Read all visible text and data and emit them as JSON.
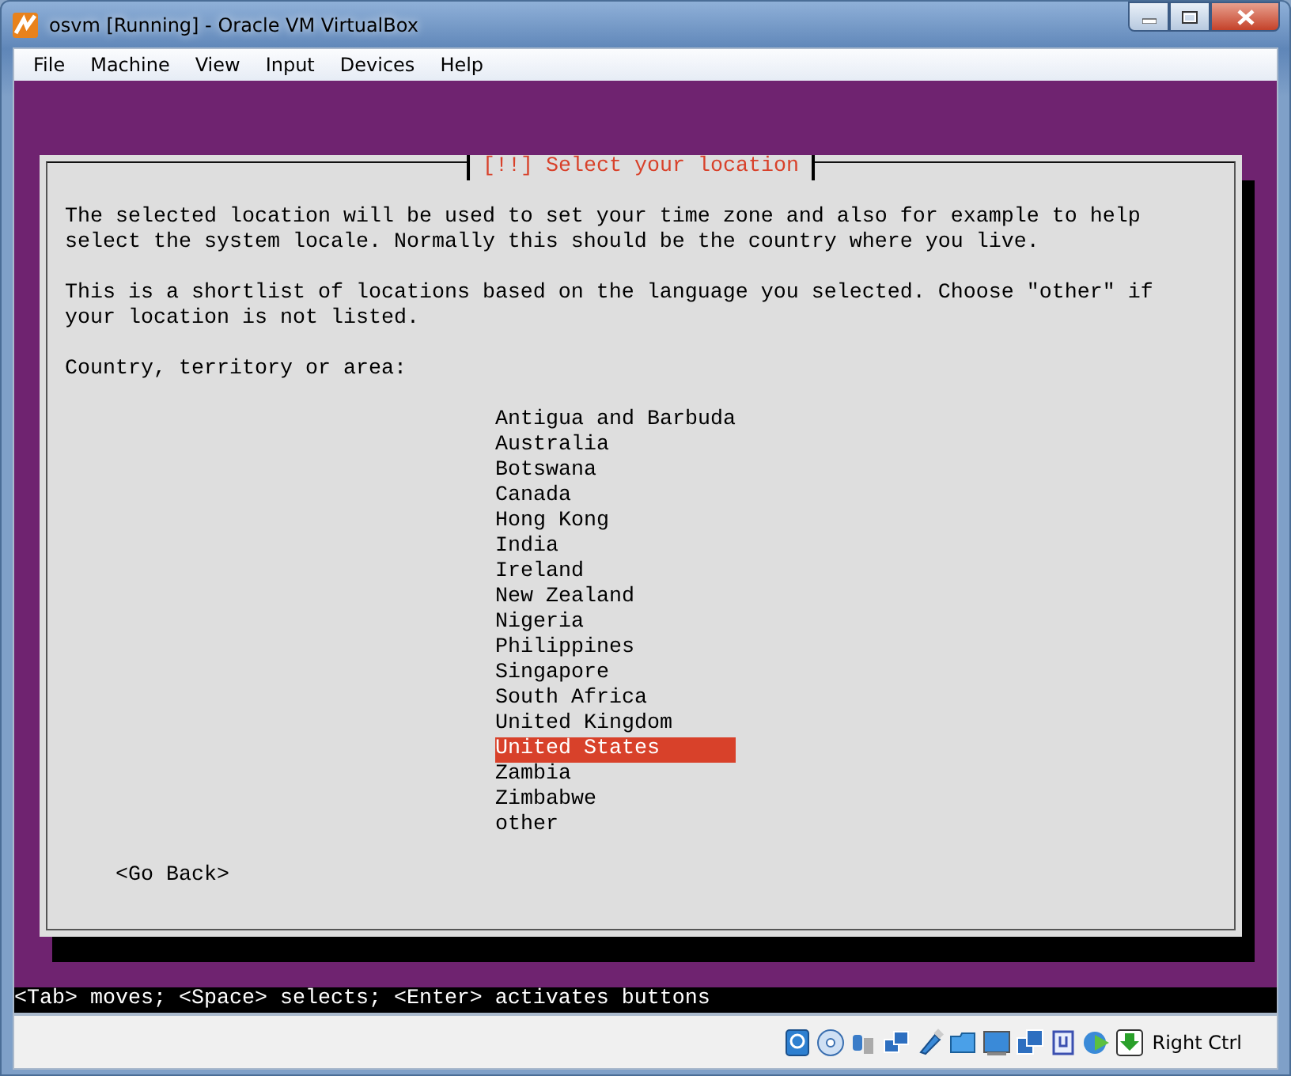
{
  "window": {
    "title": "osvm [Running] - Oracle VM VirtualBox"
  },
  "menu": [
    "File",
    "Machine",
    "View",
    "Input",
    "Devices",
    "Help"
  ],
  "dialog": {
    "title": "[!!] Select your location",
    "paragraphs": [
      "The selected location will be used to set your time zone and also for example to help select the system locale. Normally this should be the country where you live.",
      "This is a shortlist of locations based on the language you selected. Choose \"other\" if your location is not listed."
    ],
    "prompt": "Country, territory or area:",
    "countries": [
      {
        "name": "Antigua and Barbuda",
        "selected": false
      },
      {
        "name": "Australia",
        "selected": false
      },
      {
        "name": "Botswana",
        "selected": false
      },
      {
        "name": "Canada",
        "selected": false
      },
      {
        "name": "Hong Kong",
        "selected": false
      },
      {
        "name": "India",
        "selected": false
      },
      {
        "name": "Ireland",
        "selected": false
      },
      {
        "name": "New Zealand",
        "selected": false
      },
      {
        "name": "Nigeria",
        "selected": false
      },
      {
        "name": "Philippines",
        "selected": false
      },
      {
        "name": "Singapore",
        "selected": false
      },
      {
        "name": "South Africa",
        "selected": false
      },
      {
        "name": "United Kingdom",
        "selected": false
      },
      {
        "name": "United States",
        "selected": true
      },
      {
        "name": "Zambia",
        "selected": false
      },
      {
        "name": "Zimbabwe",
        "selected": false
      },
      {
        "name": "other",
        "selected": false
      }
    ],
    "back_button": "<Go Back>"
  },
  "help_line": "<Tab> moves; <Space> selects; <Enter> activates buttons",
  "status_bar": {
    "host_key": "Right Ctrl"
  }
}
